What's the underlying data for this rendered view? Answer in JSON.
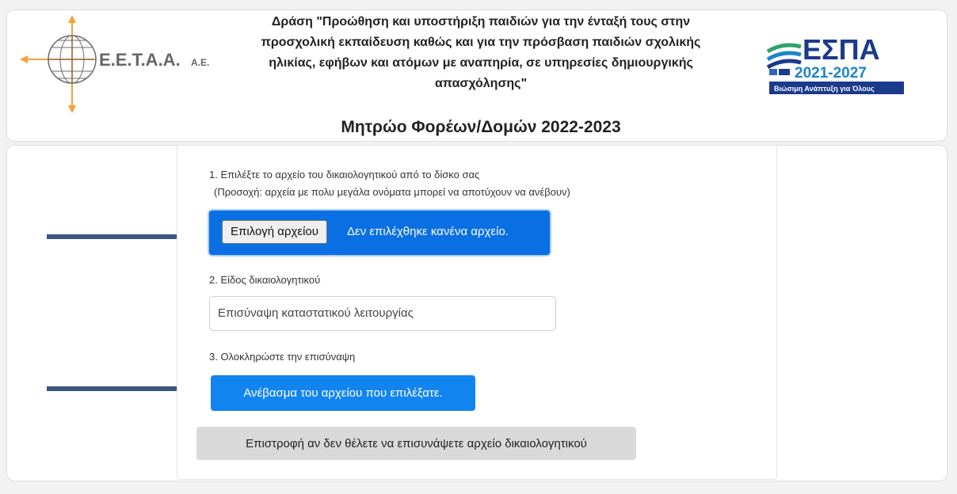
{
  "header": {
    "left_logo_text": "E.E.T.A.A.",
    "left_logo_suffix": "A.E.",
    "action_title": "Δράση \"Προώθηση και υποστήριξη παιδιών για την ένταξή τους στην προσχολική εκπαίδευση καθώς και για την πρόσβαση παιδιών σχολικής ηλικίας, εφήβων και ατόμων με αναπηρία, σε υπηρεσίες δημιουργικής απασχόλησης\"",
    "registry_title": "Μητρώο Φορέων/Δομών 2022-2023",
    "right_logo_text": "ΕΣΠΑ",
    "right_logo_years": "2021-2027",
    "right_logo_tagline": "Βιώσιμη Ανάπτυξη για Όλους"
  },
  "form": {
    "step1_label": "1. Επιλέξτε το αρχείο του δικαιολογητικού από το δίσκο σας",
    "step1_note": "(Προσοχή: αρχεία με πολυ μεγάλα ονόματα μπορεί να αποτύχουν να ανέβουν)",
    "file_choose_label": "Επιλογή αρχείου",
    "file_status": "Δεν επιλέχθηκε κανένα αρχείο.",
    "step2_label": "2. Είδος δικαιολογητικού",
    "doc_type_value": "Επισύναψη καταστατικού λειτουργίας",
    "step3_label": "3. Ολοκληρώστε την επισύναψη",
    "upload_button_label": "Ανέβασμα του αρχείου που επιλέξατε.",
    "back_button_label": "Επιστροφή αν δεν θέλετε να επισυνάψετε αρχείο δικαιολογητικού"
  },
  "colors": {
    "primary": "#0a6fe3",
    "upload_button": "#1284f0",
    "arrow": "#3d5680",
    "logo_orange": "#f2a23a",
    "espa_blue": "#1a3a8c",
    "espa_green": "#2fa36b"
  },
  "icons": {
    "annotation_arrow": "arrow-right-icon"
  }
}
